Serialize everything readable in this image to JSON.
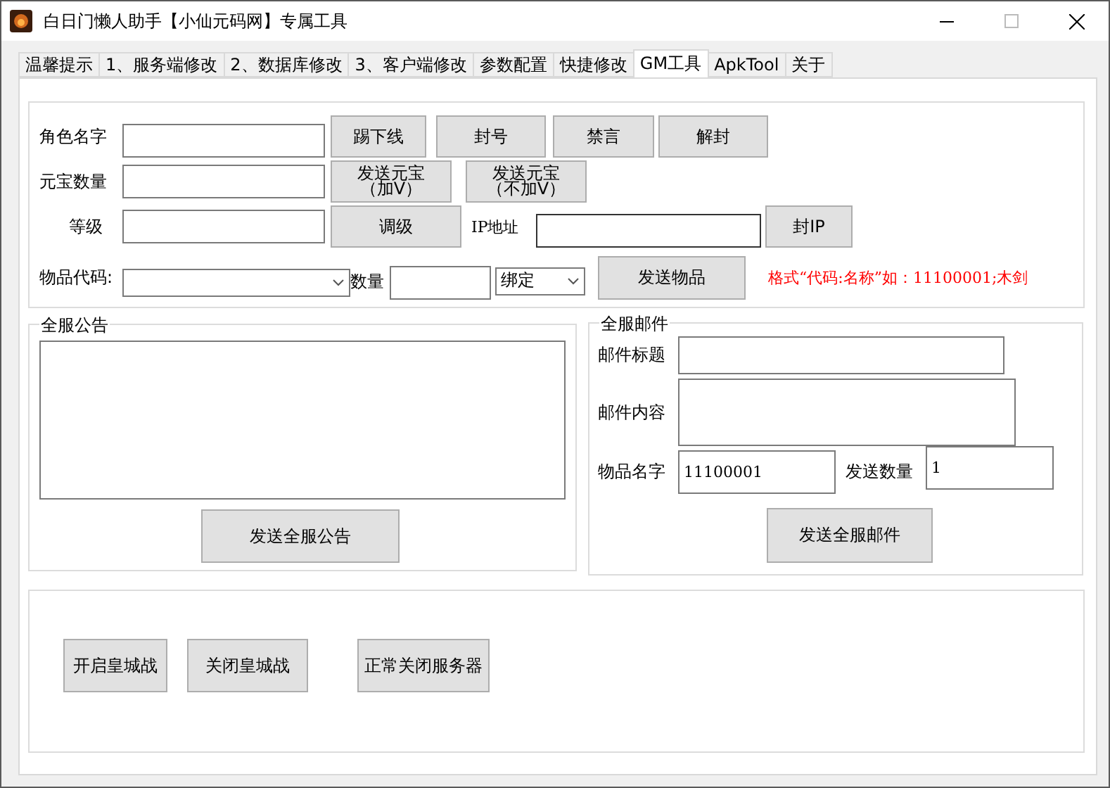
{
  "window": {
    "title": "白日门懒人助手【小仙元码网】专属工具"
  },
  "tabs": [
    {
      "label": "温馨提示",
      "selected": false
    },
    {
      "label": "1、服务端修改",
      "selected": false
    },
    {
      "label": "2、数据库修改",
      "selected": false
    },
    {
      "label": "3、客户端修改",
      "selected": false
    },
    {
      "label": "参数配置",
      "selected": false
    },
    {
      "label": "快捷修改",
      "selected": false
    },
    {
      "label": "GM工具",
      "selected": true
    },
    {
      "label": "ApkTool",
      "selected": false
    },
    {
      "label": "关于",
      "selected": false
    }
  ],
  "player": {
    "name_label": "角色名字",
    "buttons": [
      "踢下线",
      "封号",
      "禁言",
      "解封"
    ],
    "ingot_label": "元宝数量",
    "ingot_buttons": [
      [
        "发送元宝",
        "（加V）"
      ],
      [
        "发送元宝",
        "（不加V）"
      ]
    ],
    "level_label": "等级",
    "level_button": "调级",
    "ip_label": "IP地址",
    "ip_button": "封IP",
    "item_code_label": "物品代码:",
    "qty_label": "数量",
    "bind_value": "绑定",
    "send_item_button": "发送物品",
    "hint": "格式“代码:名称”如：11100001;木剑"
  },
  "announcement": {
    "title": "全服公告",
    "button": "发送全服公告"
  },
  "mail": {
    "title": "全服邮件",
    "subject_label": "邮件标题",
    "content_label": "邮件内容",
    "item_label": "物品名字",
    "item_value": "11100001",
    "qty_label": "发送数量",
    "qty_value": "1",
    "button": "发送全服邮件"
  },
  "server_buttons": [
    "开启皇城战",
    "关闭皇城战",
    "正常关闭服务器"
  ]
}
